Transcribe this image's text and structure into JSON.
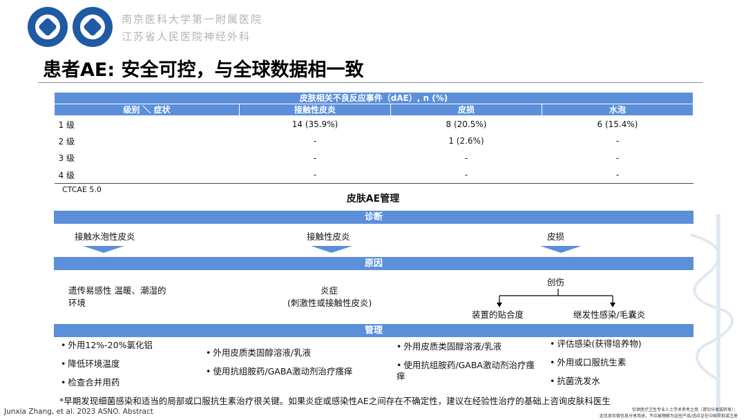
{
  "header": {
    "hospital_line1": "南京医科大学第一附属医院",
    "hospital_line2": "江苏省人民医院神经外科",
    "logos": [
      "hospital-logo-1",
      "hospital-logo-2"
    ]
  },
  "title": "患者AE: 安全可控，与全球数据相一致",
  "table": {
    "caption": "皮肤相关不良反应事件（dAE）, n (%)",
    "headers": [
      "级别 ＼ 症状",
      "接触性皮炎",
      "皮损",
      "水泡"
    ],
    "rows": [
      [
        "1 级",
        "14 (35.9%)",
        "8 (20.5%)",
        "6 (15.4%)"
      ],
      [
        "2 级",
        "-",
        "1 (2.6%)",
        "-"
      ],
      [
        "3 级",
        "-",
        "-",
        "-"
      ],
      [
        "4 级",
        "-",
        "-",
        "-"
      ]
    ],
    "footnote": "CTCAE 5.0"
  },
  "management": {
    "title": "皮肤AE管理",
    "diagnosis": {
      "label": "诊断",
      "items": [
        "接触水泡性皮炎",
        "接触性皮炎",
        "皮损"
      ]
    },
    "cause": {
      "label": "原因",
      "items": [
        "遗传易感性 温暖、潮湿的环境",
        "炎症",
        "(刺激性或接触性皮炎)",
        "创伤",
        "装置的贴合度",
        "继发性感染/毛囊炎"
      ]
    },
    "manage": {
      "label": "管理",
      "col1": [
        "外用12%-20%氯化铝",
        "降低环境温度",
        "检查合并用药"
      ],
      "col2": [
        "外用皮质类固醇溶液/乳液",
        "使用抗组胺药/GABA激动剂治疗瘙痒"
      ],
      "col3": [
        "外用皮质类固醇溶液/乳液",
        "使用抗组胺药/GABA激动剂治疗瘙痒"
      ],
      "col4": [
        "评估感染(获得培养物)",
        "外用或口服抗生素",
        "抗菌洗发水"
      ]
    }
  },
  "note": "*早期发现细菌感染和适当的局部或口服抗生素治疗很关键。如果炎症或感染性AE之间存在不确定性，建议在经验性治疗的基础上咨询皮肤科医生",
  "citation": "Junxia Zhang, et al. 2023 ASNO. Abstract",
  "disclaimer": {
    "line1": "仅供医疗卫生专业人士学术参考之用（请勿分发或转发）；",
    "line2": "此信息仅做信息分享用途，不应被理解为这些产品/适应证在中国获批或注册"
  },
  "colors": {
    "accent": "#5b8fd9",
    "hospital_text": "#b3b3b3"
  }
}
